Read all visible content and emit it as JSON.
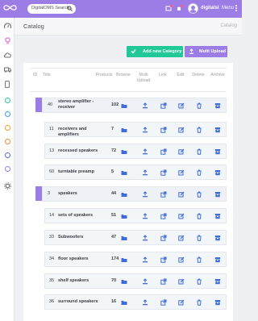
{
  "topbar": {
    "search_placeholder": "DigitalOMS Search...",
    "user_name": "digitalsl",
    "menu_label": "Menu"
  },
  "header": {
    "page_title": "Catalog",
    "breadcrumb": "Catalog"
  },
  "actions": {
    "add_category": "Add new Category",
    "multi_upload": "Multi Upload"
  },
  "table": {
    "columns": {
      "id": "ID",
      "title": "Title",
      "products": "Products",
      "browse": "Browse",
      "multi_upload": "Multi Upload",
      "link": "Link",
      "edit": "Edit",
      "delete": "Delete",
      "archive": "Archive"
    },
    "rows": [
      {
        "id": "40",
        "title": "stereo amplifier - receiver",
        "products": "102",
        "level": "parent"
      },
      {
        "id": "11",
        "title": "receivers and amplifiers",
        "products": "7",
        "level": "child"
      },
      {
        "id": "13",
        "title": "recessed speakers",
        "products": "72",
        "level": "child"
      },
      {
        "id": "60",
        "title": "turntable preamp",
        "products": "5",
        "level": "child"
      },
      {
        "id": "3",
        "title": "speakers",
        "products": "44",
        "level": "parent"
      },
      {
        "id": "14",
        "title": "sets of speakers",
        "products": "51",
        "level": "child"
      },
      {
        "id": "33",
        "title": "Subwoofers",
        "products": "47",
        "level": "child"
      },
      {
        "id": "34",
        "title": "floor speakers",
        "products": "174",
        "level": "child"
      },
      {
        "id": "35",
        "title": "shelf speakers",
        "products": "70",
        "level": "child"
      },
      {
        "id": "36",
        "title": "surround speakers",
        "products": "16",
        "level": "child"
      }
    ]
  },
  "colors": {
    "accent": "#9c7de6",
    "success": "#20c997",
    "icon": "#3f6cd6"
  }
}
